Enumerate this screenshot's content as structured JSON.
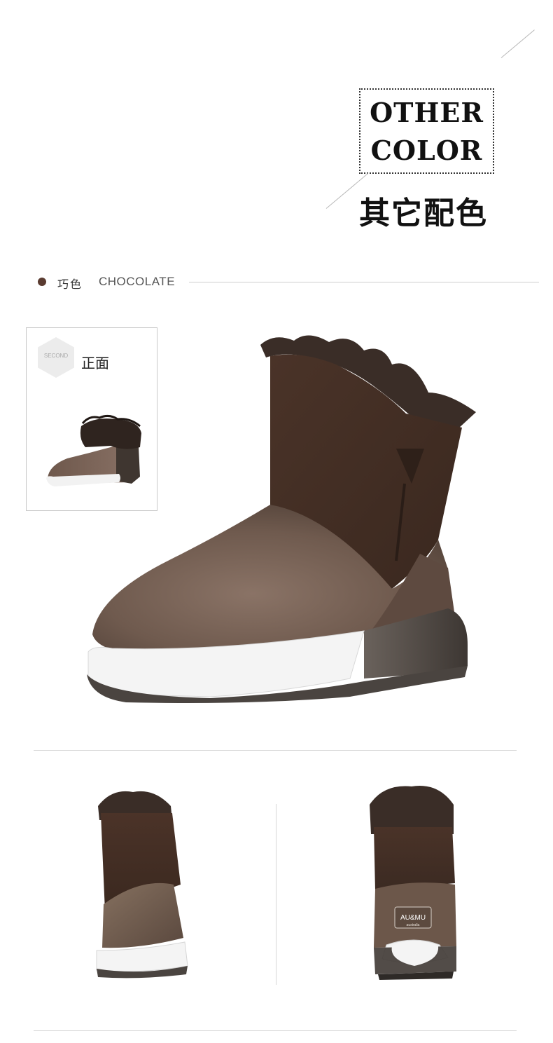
{
  "header": {
    "title_line1": "OTHER",
    "title_line2": "COLOR",
    "title_cn": "其它配色"
  },
  "color_row": {
    "swatch_color": "#5a3b30",
    "name_cn": "巧色",
    "name_en": "CHOCOLATE"
  },
  "thumbnail": {
    "hex_label": "SECOND",
    "view_label": "正面"
  },
  "back_view": {
    "brand_main": "AU&MU",
    "brand_sub": "australia"
  },
  "colors": {
    "suede_dark": "#4a3328",
    "suede_light": "#7a6356",
    "sole_white": "#f4f4f4",
    "sole_dark": "#4a4440"
  }
}
